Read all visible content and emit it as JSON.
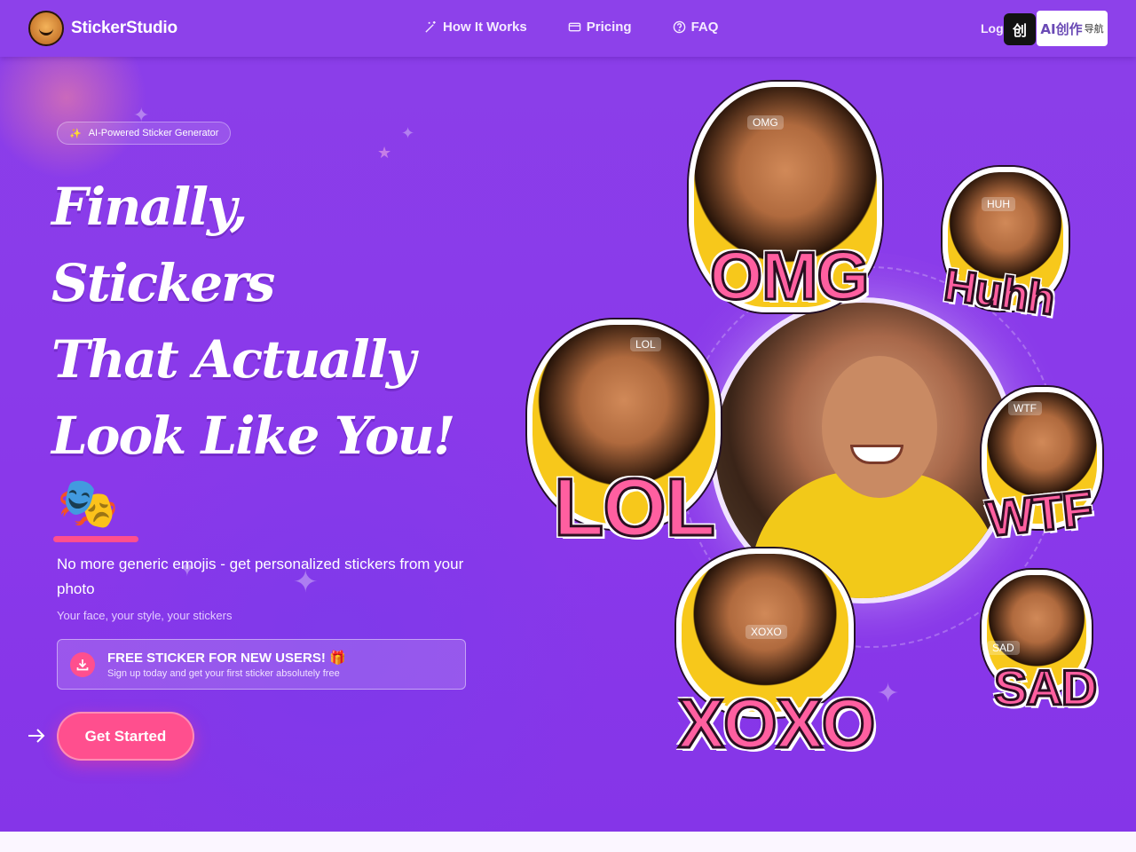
{
  "brand": {
    "name": "StickerStudio",
    "logo_icon": "cartoon-face-icon"
  },
  "nav": {
    "links": [
      {
        "label": "How It Works",
        "icon": "magic-wand-icon"
      },
      {
        "label": "Pricing",
        "icon": "card-icon"
      },
      {
        "label": "FAQ",
        "icon": "question-circle-icon"
      }
    ],
    "login_label": "Log",
    "ext_dark_label": "创",
    "ext_light_label": "AI创作",
    "ext_light_sub": "导航"
  },
  "hero": {
    "badge": "AI-Powered Sticker Generator",
    "badge_icon": "sparkles-icon",
    "headline_lines": [
      "Finally,",
      "Stickers",
      "That Actually",
      "Look Like You!"
    ],
    "emoji": "🎭",
    "lead": "No more generic emojis - get personalized stickers from your photo",
    "sub": "Your face, your style, your stickers",
    "promo": {
      "title": "FREE STICKER FOR NEW USERS! 🎁",
      "subtitle": "Sign up today and get your first sticker absolutely free",
      "icon": "download-icon"
    },
    "cta_label": "Get Started",
    "arrow_icon": "arrow-right-icon"
  },
  "stickers": [
    {
      "word": "OMG",
      "tag": "OMG"
    },
    {
      "word": "Huhh",
      "tag": "HUH"
    },
    {
      "word": "LOL",
      "tag": "LOL"
    },
    {
      "word": "WTF",
      "tag": "WTF"
    },
    {
      "word": "XOXO",
      "tag": "XOXO"
    },
    {
      "word": "SAD",
      "tag": "SAD"
    }
  ],
  "colors": {
    "primary": "#8a3bea",
    "accent": "#ff4f8e",
    "shirt": "#f7c81b"
  }
}
